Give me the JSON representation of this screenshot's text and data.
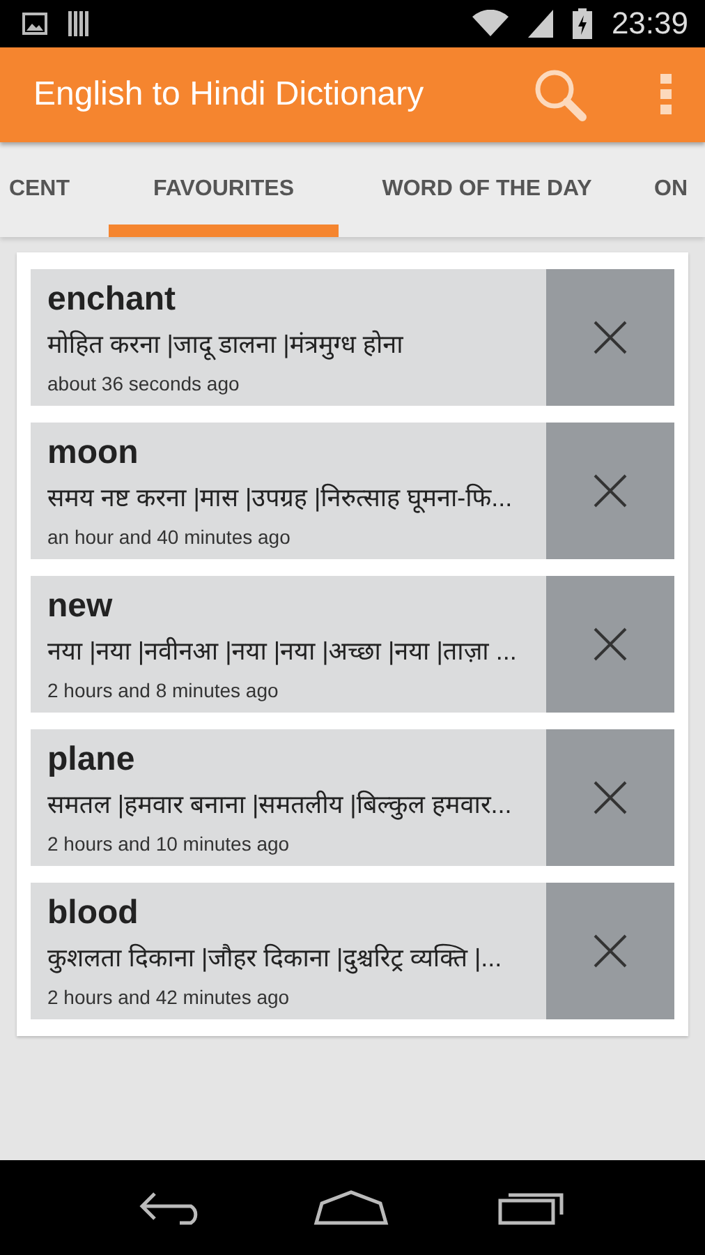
{
  "status_bar": {
    "time": "23:39"
  },
  "app_bar": {
    "title": "English to Hindi Dictionary"
  },
  "tabs": [
    {
      "label": "CENT",
      "selected": false
    },
    {
      "label": "FAVOURITES",
      "selected": true
    },
    {
      "label": "WORD OF THE DAY",
      "selected": false
    },
    {
      "label": "ON",
      "selected": false
    }
  ],
  "favourites": [
    {
      "word": "enchant",
      "meaning": "मोहित करना |जादू डालना |मंत्रमुग्ध होना",
      "time": "about 36 seconds ago"
    },
    {
      "word": "moon",
      "meaning": "समय नष्ट करना |मास |उपग्रह |निरुत्साह घूमना-फि...",
      "time": "an hour and 40 minutes ago"
    },
    {
      "word": "new",
      "meaning": "नया |नया |नवीनआ |नया |नया |अच्छा |नया |ताज़ा ...",
      "time": "2 hours and 8 minutes ago"
    },
    {
      "word": "plane",
      "meaning": "समतल |हमवार बनाना |समतलीय |बिल्कुल हमवार...",
      "time": "2 hours and 10 minutes ago"
    },
    {
      "word": "blood",
      "meaning": "कुशलता दिकाना |जौहर दिकाना |दुश्चरिट्र व्यक्ति |...",
      "time": "2 hours and 42 minutes ago"
    }
  ]
}
